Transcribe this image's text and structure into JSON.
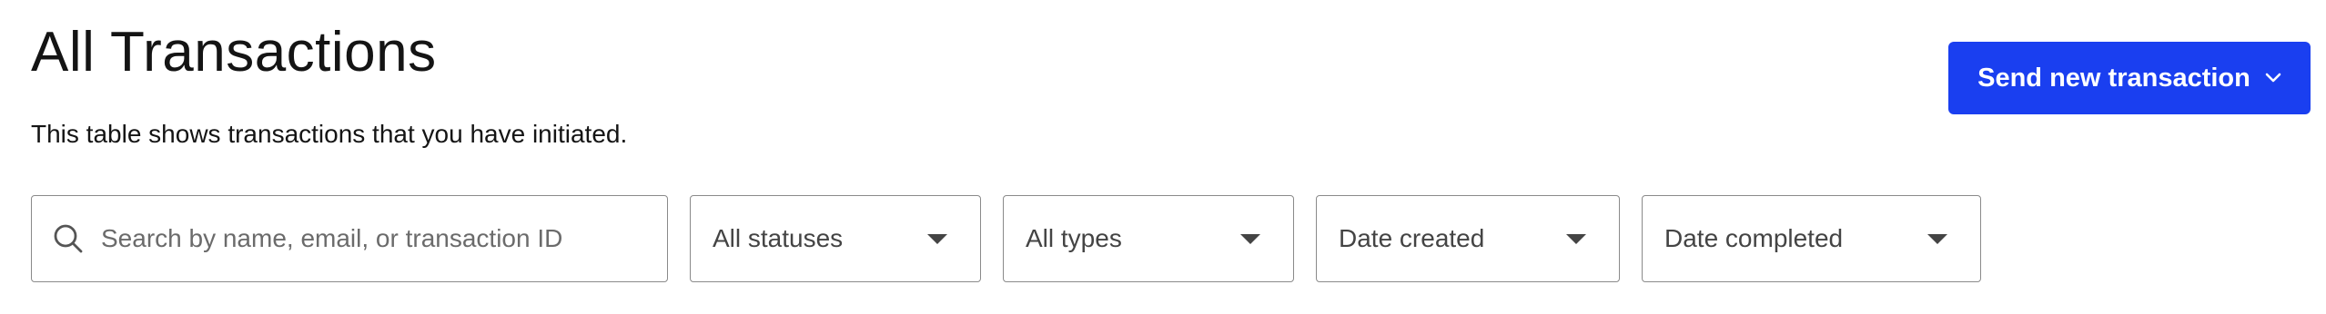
{
  "header": {
    "title": "All Transactions",
    "subtitle": "This table shows transactions that you have initiated."
  },
  "actions": {
    "send_button_label": "Send new transaction",
    "send_button_icon": "chevron-down-icon",
    "accent_color": "#1a3ff0"
  },
  "filters": {
    "search": {
      "placeholder": "Search by name, email, or transaction ID",
      "value": "",
      "icon": "search-icon"
    },
    "status": {
      "selected": "All statuses"
    },
    "type": {
      "selected": "All types"
    },
    "date_created": {
      "selected": "Date created"
    },
    "date_completed": {
      "selected": "Date completed"
    }
  }
}
